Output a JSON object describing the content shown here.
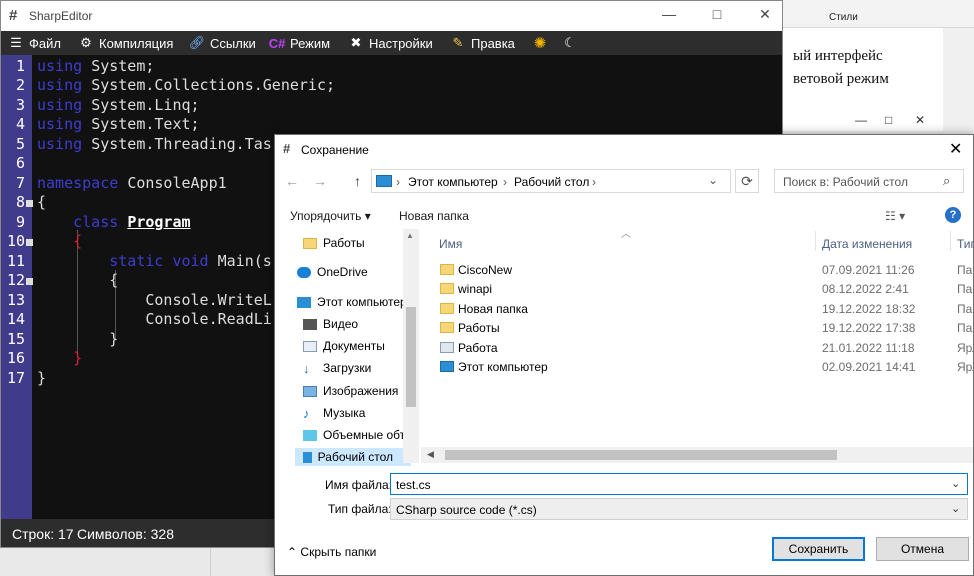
{
  "background_doc": {
    "styles_label": "Стили",
    "line1": "ый  интерфейс",
    "line2": "ветовой режим",
    "window_controls": [
      "—",
      "□",
      "✕"
    ]
  },
  "editor": {
    "title": "SharpEditor",
    "window_controls": [
      "—",
      "□",
      "✕"
    ],
    "menu": [
      {
        "label": "Файл",
        "icon": "menu-lines-icon"
      },
      {
        "label": "Компиляция",
        "icon": "gear-icon"
      },
      {
        "label": "Ссылки",
        "icon": "link-icon"
      },
      {
        "label": "Режим",
        "icon": "csharp-icon",
        "icon_text": "C#"
      },
      {
        "label": "Настройки",
        "icon": "tools-icon"
      },
      {
        "label": "Правка",
        "icon": "pencil-icon"
      }
    ],
    "theme_icons": [
      "sun-icon",
      "moon-icon"
    ],
    "line_numbers": [
      "1",
      "2",
      "3",
      "4",
      "5",
      "6",
      "7",
      "8",
      "9",
      "10",
      "11",
      "12",
      "13",
      "14",
      "15",
      "16",
      "17"
    ],
    "code_lines": [
      "using System;",
      "using System.Collections.Generic;",
      "using System.Linq;",
      "using System.Text;",
      "using System.Threading.Tas",
      "",
      "namespace ConsoleApp1",
      "{",
      "    class Program",
      "    {",
      "        static void Main(s",
      "        {",
      "            Console.WriteL",
      "            Console.ReadLi",
      "        }",
      "    }",
      "}"
    ],
    "status_lines": "Строк: 17",
    "status_chars": "Символов: 328"
  },
  "dialog": {
    "title": "Сохранение",
    "nav": [
      "←",
      "→",
      "↑"
    ],
    "address": [
      "Этот компьютер",
      "Рабочий стол"
    ],
    "search_placeholder": "Поиск в: Рабочий стол",
    "toolbar": {
      "organize": "Упорядочить ▾",
      "new_folder": "Новая папка",
      "view": "▾"
    },
    "left_pane": [
      {
        "label": "Работы",
        "icon": "folder-icon"
      },
      {
        "label": "OneDrive",
        "icon": "cloud-icon"
      },
      {
        "label": "Этот компьютер",
        "icon": "computer-icon"
      },
      {
        "label": "Видео",
        "icon": "video-icon"
      },
      {
        "label": "Документы",
        "icon": "documents-icon"
      },
      {
        "label": "Загрузки",
        "icon": "download-icon"
      },
      {
        "label": "Изображения",
        "icon": "images-icon"
      },
      {
        "label": "Музыка",
        "icon": "music-icon"
      },
      {
        "label": "Объемные объ",
        "icon": "3d-objects-icon"
      },
      {
        "label": "Рабочий стол",
        "icon": "desktop-icon"
      }
    ],
    "columns": [
      "Имя",
      "Дата изменения",
      "Тип"
    ],
    "files": [
      {
        "name": "CiscoNew",
        "date": "07.09.2021 11:26",
        "type": "Пап",
        "icon": "folder-icon"
      },
      {
        "name": "winapi",
        "date": "08.12.2022 2:41",
        "type": "Пап",
        "icon": "folder-icon"
      },
      {
        "name": "Новая папка",
        "date": "19.12.2022 18:32",
        "type": "Пап",
        "icon": "folder-icon"
      },
      {
        "name": "Работы",
        "date": "19.12.2022 17:38",
        "type": "Пап",
        "icon": "folder-icon"
      },
      {
        "name": "Работа",
        "date": "21.01.2022 11:18",
        "type": "Ярл",
        "icon": "shortcut-icon"
      },
      {
        "name": "Этот компьютер",
        "date": "02.09.2021 14:41",
        "type": "Ярл",
        "icon": "computer-shortcut-icon"
      }
    ],
    "filename_label": "Имя файла:",
    "filename_value": "test.cs",
    "filetype_label": "Тип файла:",
    "filetype_value": "CSharp source code (*.cs)",
    "hide_folders": "Скрыть папки",
    "save": "Сохранить",
    "cancel": "Отмена"
  }
}
